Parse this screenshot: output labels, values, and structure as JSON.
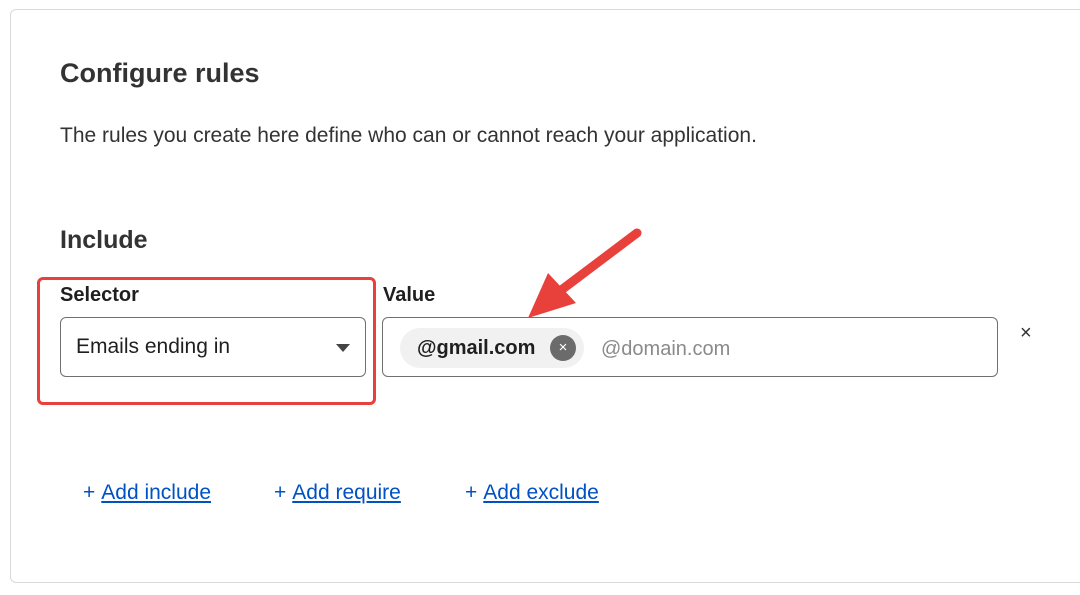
{
  "header": {
    "title": "Configure rules",
    "description": "The rules you create here define who can or cannot reach your application."
  },
  "include_section": {
    "title": "Include",
    "selector_label": "Selector",
    "value_label": "Value",
    "selector": {
      "selected": "Emails ending in"
    },
    "value": {
      "chips": [
        {
          "text": "@gmail.com",
          "remove_glyph": "×"
        }
      ],
      "placeholder": "@domain.com"
    },
    "row_remove_glyph": "×"
  },
  "actions": {
    "plus_glyph": "+",
    "add_include": "Add include",
    "add_require": "Add require",
    "add_exclude": "Add exclude"
  },
  "icons": {
    "caret": "chevron-down-icon",
    "chip_remove": "close-icon",
    "row_remove": "close-icon",
    "annotation": "arrow-icon"
  },
  "colors": {
    "annotation_red": "#e8413c",
    "link_blue": "#0051c3"
  }
}
